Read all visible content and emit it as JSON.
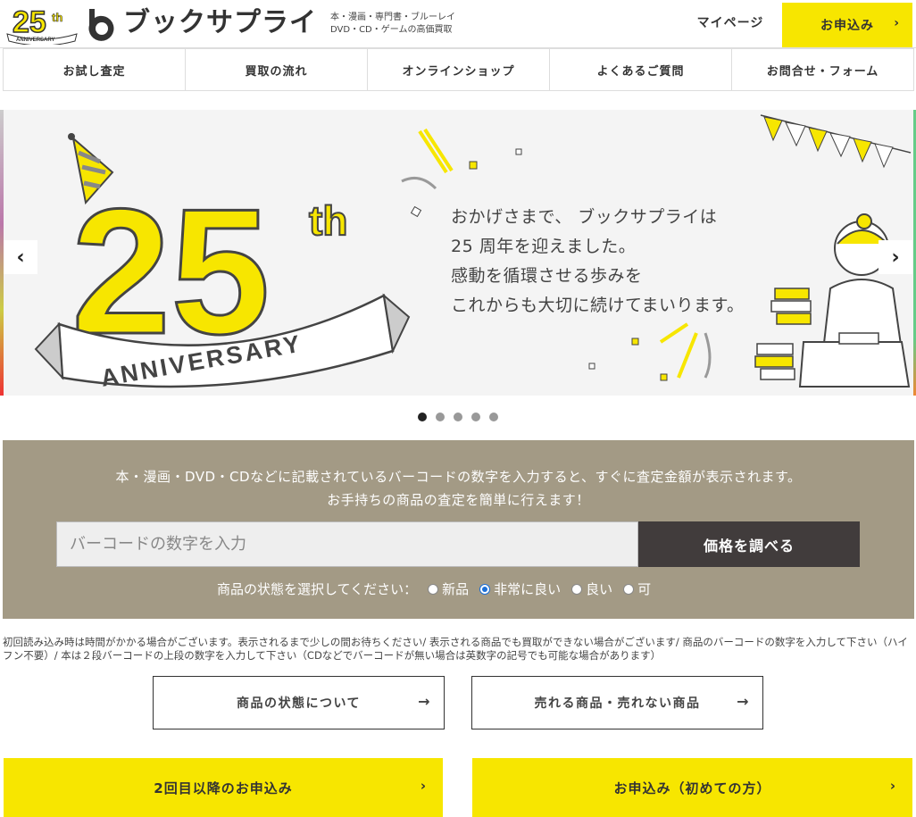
{
  "header": {
    "logo_text": "25th ANNIVERSARY",
    "brand_name": "ブックサプライ",
    "tagline_line1": "本・漫画・専門書・ブルーレイ",
    "tagline_line2": "DVD・CD・ゲームの高価買取",
    "mypage_label": "マイページ",
    "apply_label": "お申込み",
    "chevron_icon": "chevron-right-icon"
  },
  "nav": {
    "items": [
      {
        "label": "お試し査定"
      },
      {
        "label": "買取の流れ"
      },
      {
        "label": "オンラインショップ"
      },
      {
        "label": "よくあるご質問"
      },
      {
        "label": "お問合せ・フォーム"
      }
    ]
  },
  "hero": {
    "anniversary_number": "25",
    "anniversary_suffix": "th",
    "ribbon_text": "ANNIVERSARY",
    "message_lines": [
      "おかげさまで、 ブックサプライは",
      "25 周年を迎えました。",
      "感動を循環させる歩みを",
      "これからも大切に続けてまいります。"
    ],
    "prev_icon": "chevron-left-icon",
    "next_icon": "chevron-right-icon",
    "slide_count": 5,
    "active_slide": 1
  },
  "search": {
    "lead_line1": "本・漫画・DVD・CDなどに記載されているバーコードの数字を入力すると、すぐに査定金額が表示されます。",
    "lead_line2": "お手持ちの商品の査定を簡単に行えます！",
    "input_placeholder": "バーコードの数字を入力",
    "input_value": "",
    "button_label": "価格を調べる",
    "condition_label": "商品の状態を選択してください：",
    "conditions": [
      {
        "label": "新品",
        "checked": false
      },
      {
        "label": "非常に良い",
        "checked": true
      },
      {
        "label": "良い",
        "checked": false
      },
      {
        "label": "可",
        "checked": false
      }
    ]
  },
  "notes": {
    "text": "初回読み込み時は時間がかかる場合がございます。表示されるまで少しの間お待ちください/ 表示される商品でも買取ができない場合がございます/ 商品のバーコードの数字を入力して下さい（ハイフン不要）/ 本は２段バーコードの上段の数字を入力して下さい（CDなどでバーコードが無い場合は英数字の記号でも可能な場合があります）"
  },
  "info_buttons": {
    "condition_label": "商品の状態について",
    "sellable_label": "売れる商品・売れない商品",
    "arrow_icon": "arrow-right-icon"
  },
  "cta": {
    "repeat_label": "2回目以降のお申込み",
    "first_label": "お申込み（初めての方）"
  },
  "colors": {
    "brand_yellow": "#f7e600",
    "panel_beige": "#a39a85",
    "button_dark": "#413c3c"
  }
}
